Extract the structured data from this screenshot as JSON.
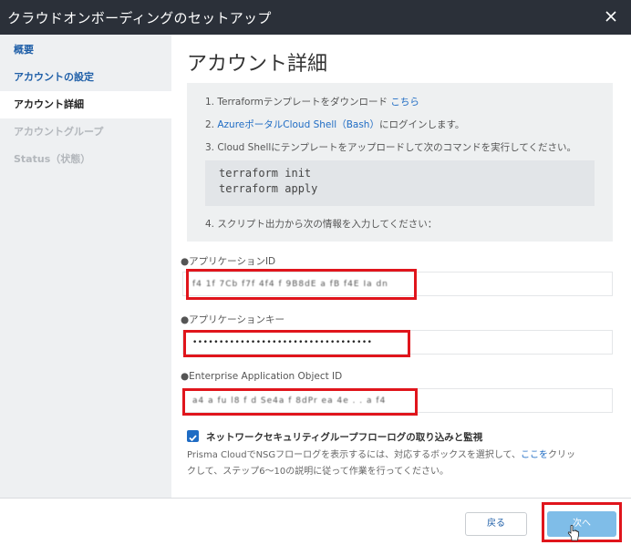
{
  "window": {
    "title": "クラウドオンボーディングのセットアップ",
    "close_icon": "close-icon"
  },
  "sidebar": {
    "items": [
      {
        "label": "概要",
        "state": "done"
      },
      {
        "label": "アカウントの設定",
        "state": "done"
      },
      {
        "label": "アカウント詳細",
        "state": "active"
      },
      {
        "label": "アカウントグループ",
        "state": "disabled"
      },
      {
        "label": "Status（状態）",
        "state": "disabled"
      }
    ]
  },
  "main": {
    "heading": "アカウント詳細",
    "steps": {
      "step1_text": "1. Terraformテンプレートをダウンロード ",
      "step1_link": "こちら",
      "step2_prefix": "2. ",
      "step2_link": "AzureポータルCloud Shell（Bash）",
      "step2_suffix": "にログインします。",
      "step3_text": "3. Cloud Shellにテンプレートをアップロードして次のコマンドを実行してください。",
      "step4_text": "4. スクリプト出力から次の情報を入力してください："
    },
    "commands": [
      "terraform init",
      "terraform apply"
    ],
    "fields": {
      "app_id_label": "●アプリケーションID",
      "app_id_value": "f4 1f 7Cb f7f 4f4 f 9B8dE a fB f4E Ia dn",
      "app_key_label": "●アプリケーションキー",
      "app_key_value": "••••••••••••••••••••••••••••••••••",
      "object_id_label": "●Enterprise Application Object ID",
      "object_id_value": "a4 a fu l8 f d Se4a f 8dPr ea 4e . . a f4"
    },
    "nsg": {
      "checked": true,
      "label": "ネットワークセキュリティグループフローログの取り込みと監視",
      "desc_line1_prefix": "Prisma CloudでNSGフローログを表示するには、対応するボックスを選択して、",
      "desc_line1_link": "ここを",
      "desc_line1_suffix": "クリッ",
      "desc_line2": "クして、ステップ6～10の説明に従って作業を行ってください。"
    }
  },
  "footer": {
    "back_label": "戻る",
    "next_label": "次へ"
  },
  "colors": {
    "titlebar": "#2b3039",
    "accent": "#1f6cc4",
    "highlight": "#e0151c",
    "next_button": "#7fbde8"
  }
}
